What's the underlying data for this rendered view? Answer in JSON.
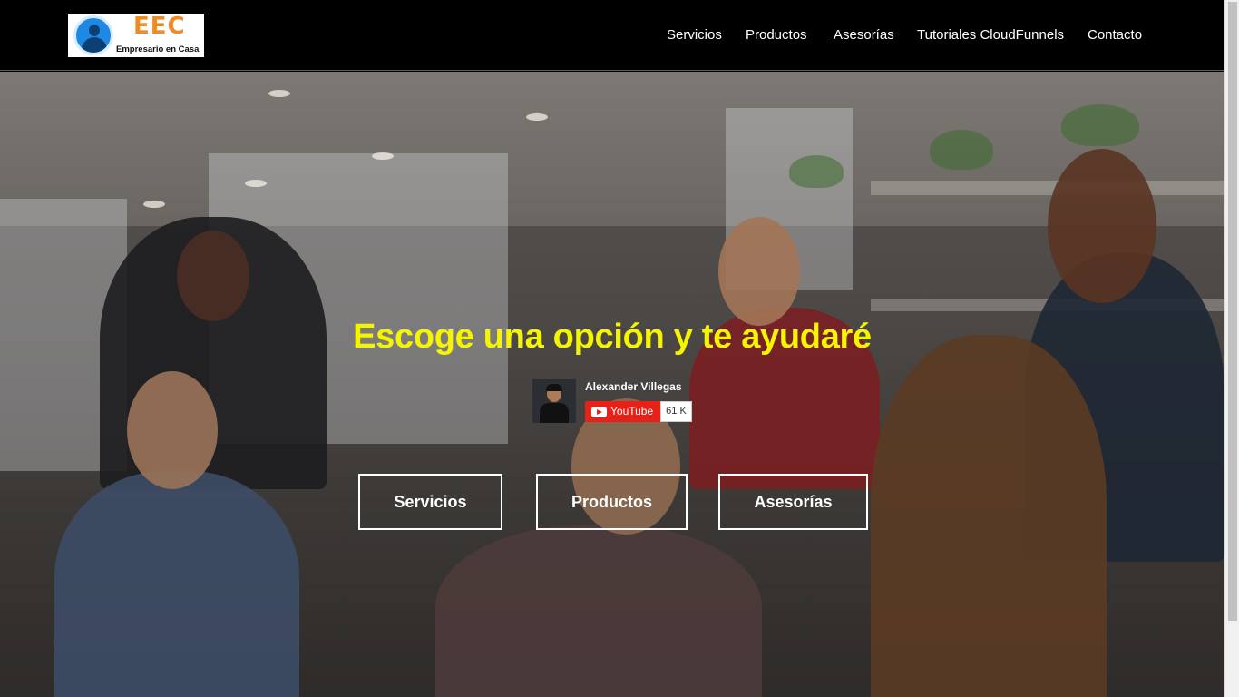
{
  "brand": {
    "abbr": "EEC",
    "name": "Empresario en Casa",
    "icon": "businessman-icon"
  },
  "nav": {
    "items": [
      {
        "label": "Servicios"
      },
      {
        "label": "Productos"
      },
      {
        "label": "Asesorías"
      },
      {
        "label": "Tutoriales CloudFunnels"
      },
      {
        "label": "Contacto"
      }
    ]
  },
  "hero": {
    "title": "Escoge una opción y te ayudaré",
    "title_color": "#f5f500",
    "youtube": {
      "channel_name": "Alexander Villegas",
      "button_label": "YouTube",
      "subscriber_count": "61 K",
      "button_color": "#e62117"
    },
    "buttons": [
      {
        "label": "Servicios"
      },
      {
        "label": "Productos"
      },
      {
        "label": "Asesorías"
      }
    ]
  }
}
